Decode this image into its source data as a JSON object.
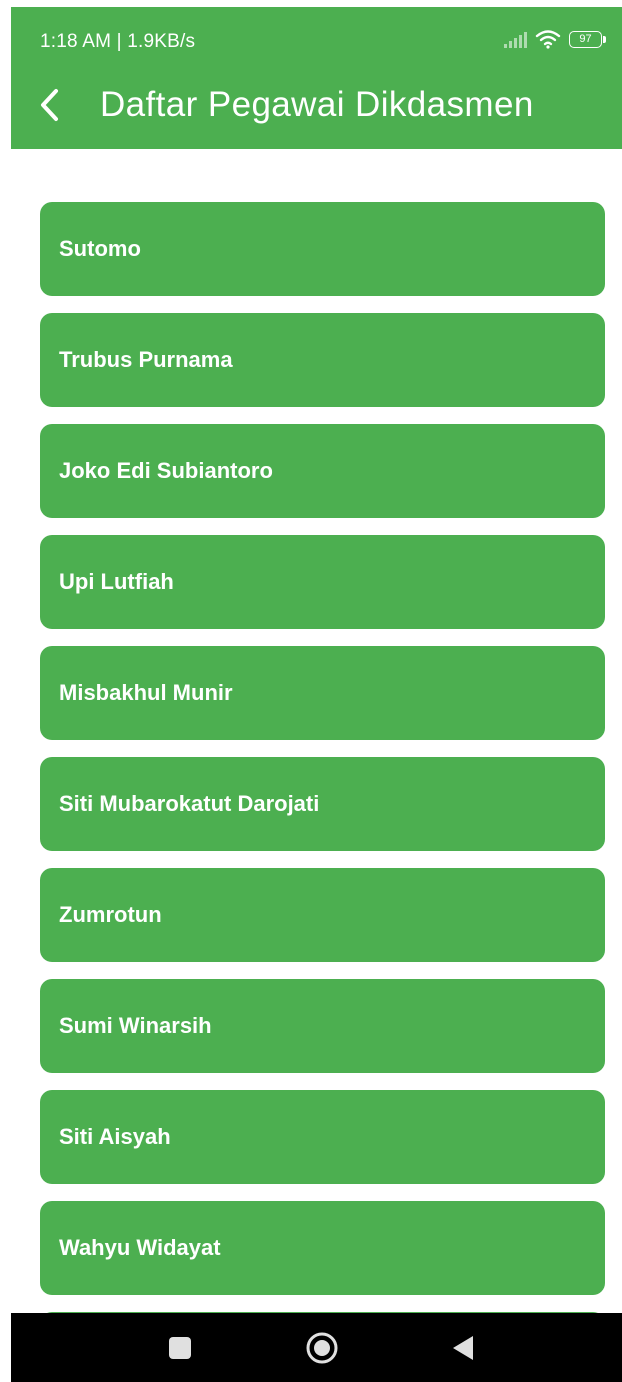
{
  "status_bar": {
    "time_speed": "1:18 AM | 1.9KB/s",
    "battery": "97",
    "icons": [
      "signal-icon",
      "wifi-icon",
      "battery-icon"
    ]
  },
  "app_bar": {
    "back_icon": "back-arrow-icon",
    "title": "Daftar Pegawai Dikdasmen"
  },
  "employees": [
    "Sutomo",
    "Trubus Purnama",
    "Joko Edi Subiantoro",
    "Upi Lutfiah",
    "Misbakhul Munir",
    "Siti Mubarokatut Darojati",
    "Zumrotun",
    "Sumi Winarsih",
    "Siti Aisyah",
    "Wahyu Widayat",
    ""
  ],
  "nav_bar": {
    "icons": [
      "recents-square-icon",
      "home-circle-icon",
      "back-triangle-icon"
    ]
  },
  "colors": {
    "primary": "#4caf50",
    "on_primary": "#ffffff",
    "nav_bar": "#000000"
  }
}
